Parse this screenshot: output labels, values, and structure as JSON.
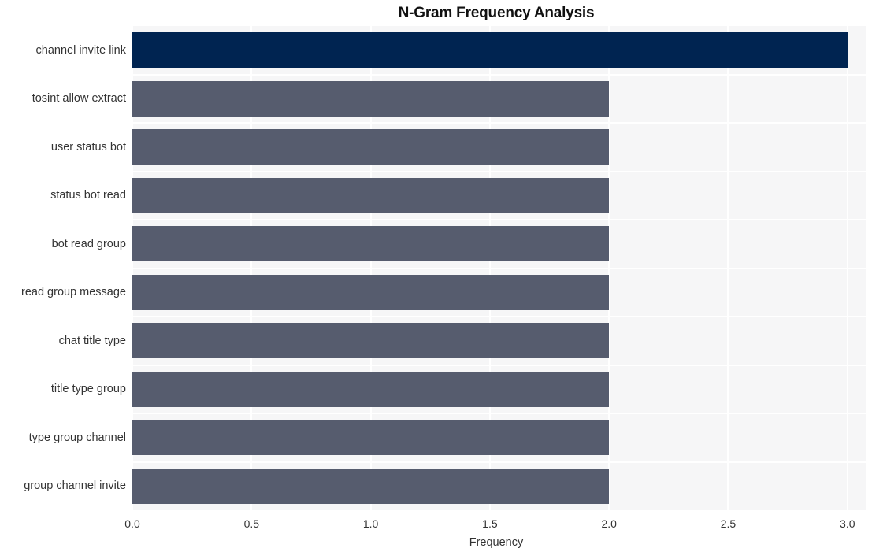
{
  "chart_data": {
    "type": "bar",
    "orientation": "horizontal",
    "title": "N-Gram Frequency Analysis",
    "xlabel": "Frequency",
    "ylabel": "",
    "categories": [
      "channel invite link",
      "tosint allow extract",
      "user status bot",
      "status bot read",
      "bot read group",
      "read group message",
      "chat title type",
      "title type group",
      "type group channel",
      "group channel invite"
    ],
    "values": [
      3,
      2,
      2,
      2,
      2,
      2,
      2,
      2,
      2,
      2
    ],
    "bar_colors": [
      "#002451",
      "#565c6e",
      "#565c6e",
      "#565c6e",
      "#565c6e",
      "#565c6e",
      "#565c6e",
      "#565c6e",
      "#565c6e",
      "#565c6e"
    ],
    "xlim": [
      0,
      3.08
    ],
    "ylim": [
      0,
      10
    ],
    "xticks": [
      0,
      0.5,
      1,
      1.5,
      2,
      2.5,
      3
    ],
    "xticklabels": [
      "0.0",
      "0.5",
      "1.0",
      "1.5",
      "2.0",
      "2.5",
      "3.0"
    ],
    "grid": true,
    "grid_color": "#ffffff",
    "plot_background": "#f6f6f7",
    "figure_background": "#ffffff",
    "legend": null,
    "highlight_color": "#002451",
    "default_bar_color": "#565c6e"
  }
}
